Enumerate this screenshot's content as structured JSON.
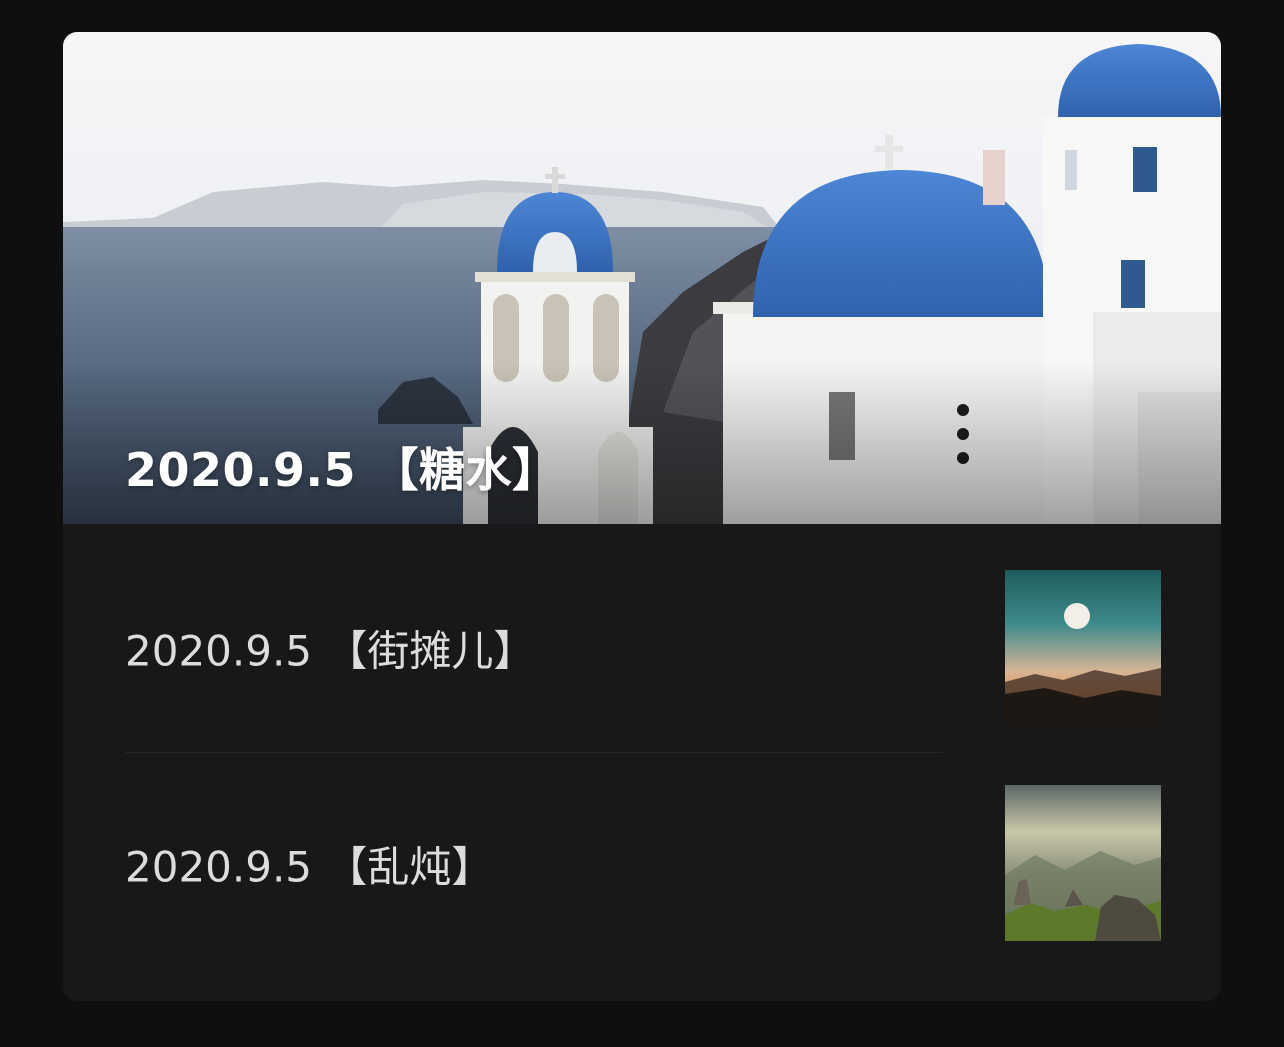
{
  "featured": {
    "title": "2020.9.5 【糖水】",
    "image": "santorini-blue-dome-church"
  },
  "articles": [
    {
      "title": "2020.9.5 【街摊儿】",
      "thumbnail": "moon-over-mountains-sunset"
    },
    {
      "title": "2020.9.5 【乱炖】",
      "thumbnail": "misty-green-mountain-valley"
    }
  ],
  "colors": {
    "page_bg": "#0f0f10",
    "card_bg": "#181819",
    "text_primary": "#ffffff",
    "text_secondary": "#dcdcdc",
    "dome_blue": "#3f78c9"
  }
}
